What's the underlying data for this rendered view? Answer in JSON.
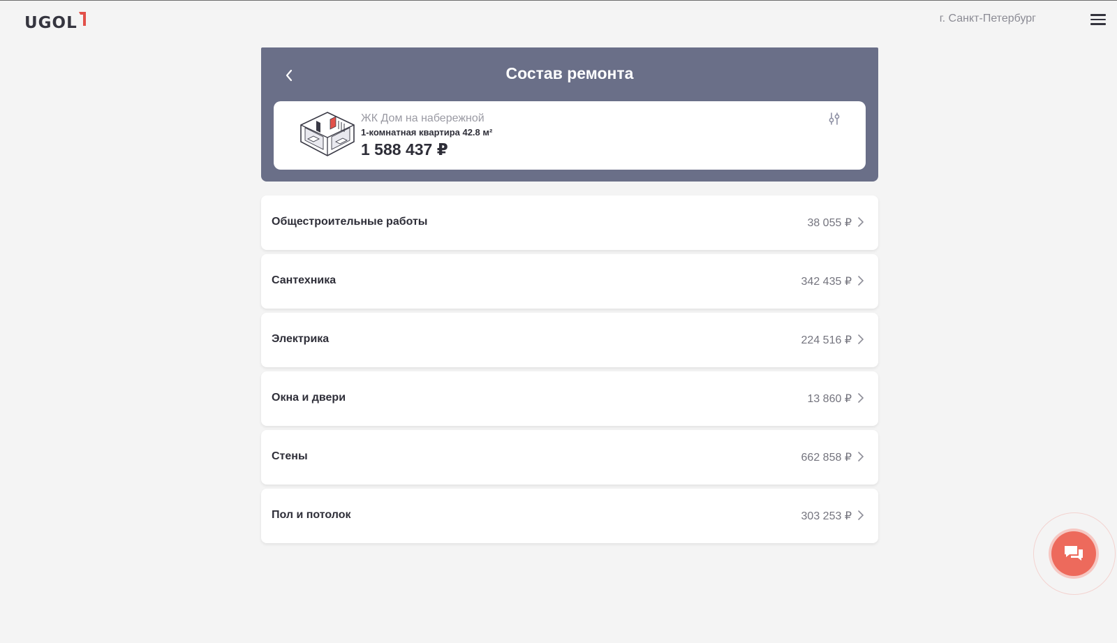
{
  "header": {
    "logo_text": "UGOL",
    "city": "г. Санкт-Петербург",
    "menu_icon": "burger-menu-icon"
  },
  "panel": {
    "title": "Состав ремонта",
    "back_icon": "chevron-left-icon",
    "settings_icon": "sliders-icon"
  },
  "summary": {
    "complex": "ЖК Дом на набережной",
    "apartment": "1-комнатная квартира 42.8 м²",
    "total": "1 588 437 ₽"
  },
  "items": [
    {
      "label": "Общестроительные работы",
      "price": "38 055 ₽"
    },
    {
      "label": "Сантехника",
      "price": "342 435 ₽"
    },
    {
      "label": "Электрика",
      "price": "224 516 ₽"
    },
    {
      "label": "Окна и двери",
      "price": "13 860 ₽"
    },
    {
      "label": "Стены",
      "price": "662 858 ₽"
    },
    {
      "label": "Пол и потолок",
      "price": "303 253 ₽"
    }
  ],
  "chat": {
    "icon": "chat-icon"
  },
  "colors": {
    "panel": "#6a6f88",
    "accent": "#ed6a5c",
    "background": "#f4f4f4"
  }
}
